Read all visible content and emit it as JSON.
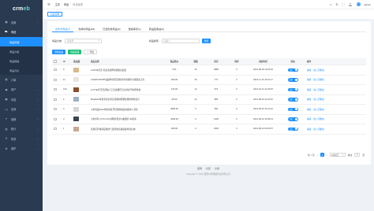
{
  "brand": {
    "logo_main": "crm",
    "logo_accent": "eb"
  },
  "sidebar": {
    "items": [
      {
        "label": "设置",
        "icon": "grid-icon",
        "state": "normal"
      },
      {
        "label": "商品",
        "icon": "cart-icon",
        "state": "open"
      },
      {
        "label": "商品管理",
        "sub": true,
        "state": "active"
      },
      {
        "label": "商品分类",
        "sub": true,
        "state": "normal"
      },
      {
        "label": "商品规格",
        "sub": true,
        "state": "normal"
      },
      {
        "label": "商品评论",
        "sub": true,
        "state": "normal"
      },
      {
        "label": "订单",
        "icon": "order-icon",
        "state": "normal"
      },
      {
        "label": "用户",
        "icon": "user-icon",
        "state": "normal"
      },
      {
        "label": "内容",
        "icon": "content-icon",
        "state": "normal"
      },
      {
        "label": "应用",
        "icon": "app-icon",
        "state": "normal"
      },
      {
        "label": "营销",
        "icon": "marketing-icon",
        "state": "normal"
      },
      {
        "label": "统计",
        "icon": "stats-icon",
        "state": "normal"
      },
      {
        "label": "财务",
        "icon": "finance-icon",
        "state": "normal"
      },
      {
        "label": "维护",
        "icon": "maintain-icon",
        "state": "normal"
      }
    ]
  },
  "topbar": {
    "breadcrumb": [
      "主页",
      "商品",
      "商品管理"
    ],
    "username": "admin"
  },
  "tagbar": {
    "active_tag": "商品管理"
  },
  "tabs": [
    {
      "label": "出售中商品(7)",
      "active": true
    },
    {
      "label": "仓库中商品(49)",
      "active": false
    },
    {
      "label": "已经售罄商品(0)",
      "active": false
    },
    {
      "label": "警戒库存(1)",
      "active": false
    },
    {
      "label": "商品回收站(0)",
      "active": false
    }
  ],
  "filters": {
    "category_label": "商品分类:",
    "category_placeholder": "请选择",
    "search_label": "商品搜索:",
    "search_placeholder": "请输入",
    "search_button": "搜索"
  },
  "actions": {
    "add": "添加商品",
    "collect": "商品采集",
    "export": "导出"
  },
  "table": {
    "headers": [
      "ID",
      "商品图",
      "商品名称",
      "商品售价",
      "销量",
      "库存",
      "排序",
      "添加时间",
      "状态",
      "操作"
    ],
    "rows": [
      {
        "id": "9",
        "name": "LOFFIE苦荞 荞麦茶加厚护颈枕头套装",
        "price": "0.01",
        "sales": "20",
        "stock": "9980",
        "sort": "0",
        "time": "2021-08-18 15:29:02",
        "status": "上架",
        "color": "#d9b98a"
      },
      {
        "id": "11",
        "name": "CHARLIN/OPPA品牌时尚百搭纯色单肩斜挎大容量女士包",
        "price": "299.00",
        "sales": "30",
        "stock": "774",
        "sort": "0",
        "time": "2021-11-16 15:21:17",
        "status": "上架",
        "color": "#e8e4de"
      },
      {
        "id": "133",
        "name": "LOTTE/乐天无添加人工色素甜巧克力棒饼干休闲零食",
        "price": "126.00",
        "sales": "12",
        "stock": "574",
        "sort": "0",
        "time": "2021-10-14 11:26:45",
        "status": "上架",
        "color": "#8a4f2c"
      },
      {
        "id": "5",
        "name": "Mejlefeld苹果手机全屏高清保护膜钢化膜防摔抗蓝光",
        "price": "59.00",
        "sales": "24",
        "stock": "886",
        "sort": "0",
        "time": "2021-08-16 11:18:32",
        "status": "上架",
        "color": "#9fb0c7"
      },
      {
        "id": "4",
        "name": "小米有品2022年新款蓝牙耳机降噪运动迷你入耳式",
        "price": "2899.00",
        "sales": "6",
        "stock": "994",
        "sort": "0",
        "time": "2021-08-16 11:16:22",
        "status": "上架",
        "color": "#d6d6d6"
      },
      {
        "id": "3",
        "name": "小米手机 13 Pro 5G全网通 骁龙8 曲面屏 4K超清",
        "price": "3299.00",
        "sales": "0",
        "stock": "1000",
        "sort": "0",
        "time": "2021-08-16 10:58:31",
        "status": "上架",
        "color": "#3d4450"
      },
      {
        "id": "1",
        "name": "蒂梵尼珍珠项链简约气质轻奢高级感锁骨链礼物",
        "price": "369.00",
        "sales": "0",
        "stock": "2000",
        "sort": "0",
        "time": "2021-08-13 09:29:57",
        "status": "上架",
        "color": "#c9a894"
      }
    ],
    "op_edit": "编辑",
    "op_recycle": "加入回收站"
  },
  "pager": {
    "total": "共 7 条",
    "page": "1",
    "page_size": "10条/页",
    "goto_label": "前往",
    "goto_value": "1",
    "page_suffix": "页"
  },
  "footer": {
    "links": [
      "官网",
      "社区",
      "文档"
    ],
    "copyright": "Copyright © 2022 西安众邦网络科技有限公司"
  }
}
